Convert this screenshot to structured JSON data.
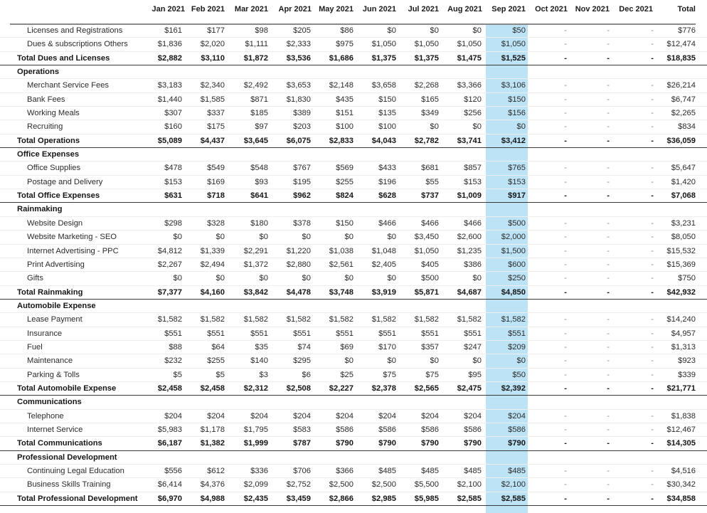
{
  "header": {
    "columns": [
      "Jan 2021",
      "Feb 2021",
      "Mar 2021",
      "Apr 2021",
      "May 2021",
      "Jun 2021",
      "Jul 2021",
      "Aug 2021",
      "Sep 2021",
      "Oct 2021",
      "Nov 2021",
      "Dec 2021",
      "Total"
    ],
    "highlighted_column": "Sep 2021"
  },
  "colors": {
    "highlight": "#bde3f6",
    "total_rule": "#3a3a3a",
    "header_rule": "#8a8a8a"
  },
  "rows": [
    {
      "type": "item",
      "label": "Licenses and Registrations",
      "values": [
        "$161",
        "$177",
        "$98",
        "$205",
        "$86",
        "$0",
        "$0",
        "$0",
        "$50",
        "-",
        "-",
        "-",
        "$776"
      ]
    },
    {
      "type": "item",
      "label": "Dues & subscriptions Others",
      "values": [
        "$1,836",
        "$2,020",
        "$1,111",
        "$2,333",
        "$975",
        "$1,050",
        "$1,050",
        "$1,050",
        "$1,050",
        "-",
        "-",
        "-",
        "$12,474"
      ]
    },
    {
      "type": "total",
      "label": "Total Dues and Licenses",
      "values": [
        "$2,882",
        "$3,110",
        "$1,872",
        "$3,536",
        "$1,686",
        "$1,375",
        "$1,375",
        "$1,475",
        "$1,525",
        "-",
        "-",
        "-",
        "$18,835"
      ]
    },
    {
      "type": "section",
      "label": "Operations"
    },
    {
      "type": "item",
      "label": "Merchant Service Fees",
      "values": [
        "$3,183",
        "$2,340",
        "$2,492",
        "$3,653",
        "$2,148",
        "$3,658",
        "$2,268",
        "$3,366",
        "$3,106",
        "-",
        "-",
        "-",
        "$26,214"
      ]
    },
    {
      "type": "item",
      "label": "Bank Fees",
      "values": [
        "$1,440",
        "$1,585",
        "$871",
        "$1,830",
        "$435",
        "$150",
        "$165",
        "$120",
        "$150",
        "-",
        "-",
        "-",
        "$6,747"
      ]
    },
    {
      "type": "item",
      "label": "Working Meals",
      "values": [
        "$307",
        "$337",
        "$185",
        "$389",
        "$151",
        "$135",
        "$349",
        "$256",
        "$156",
        "-",
        "-",
        "-",
        "$2,265"
      ]
    },
    {
      "type": "item",
      "label": "Recruiting",
      "values": [
        "$160",
        "$175",
        "$97",
        "$203",
        "$100",
        "$100",
        "$0",
        "$0",
        "$0",
        "-",
        "-",
        "-",
        "$834"
      ]
    },
    {
      "type": "total",
      "label": "Total Operations",
      "values": [
        "$5,089",
        "$4,437",
        "$3,645",
        "$6,075",
        "$2,833",
        "$4,043",
        "$2,782",
        "$3,741",
        "$3,412",
        "-",
        "-",
        "-",
        "$36,059"
      ]
    },
    {
      "type": "section",
      "label": "Office Expenses"
    },
    {
      "type": "item",
      "label": "Office Supplies",
      "values": [
        "$478",
        "$549",
        "$548",
        "$767",
        "$569",
        "$433",
        "$681",
        "$857",
        "$765",
        "-",
        "-",
        "-",
        "$5,647"
      ]
    },
    {
      "type": "item",
      "label": "Postage and Delivery",
      "values": [
        "$153",
        "$169",
        "$93",
        "$195",
        "$255",
        "$196",
        "$55",
        "$153",
        "$153",
        "-",
        "-",
        "-",
        "$1,420"
      ]
    },
    {
      "type": "total",
      "label": "Total Office Expenses",
      "values": [
        "$631",
        "$718",
        "$641",
        "$962",
        "$824",
        "$628",
        "$737",
        "$1,009",
        "$917",
        "-",
        "-",
        "-",
        "$7,068"
      ]
    },
    {
      "type": "section",
      "label": "Rainmaking"
    },
    {
      "type": "item",
      "label": "Website Design",
      "values": [
        "$298",
        "$328",
        "$180",
        "$378",
        "$150",
        "$466",
        "$466",
        "$466",
        "$500",
        "-",
        "-",
        "-",
        "$3,231"
      ]
    },
    {
      "type": "item",
      "label": "Website Marketing - SEO",
      "values": [
        "$0",
        "$0",
        "$0",
        "$0",
        "$0",
        "$0",
        "$3,450",
        "$2,600",
        "$2,000",
        "-",
        "-",
        "-",
        "$8,050"
      ]
    },
    {
      "type": "item",
      "label": "Internet Advertising - PPC",
      "values": [
        "$4,812",
        "$1,339",
        "$2,291",
        "$1,220",
        "$1,038",
        "$1,048",
        "$1,050",
        "$1,235",
        "$1,500",
        "-",
        "-",
        "-",
        "$15,532"
      ]
    },
    {
      "type": "item",
      "label": "Print Advertising",
      "values": [
        "$2,267",
        "$2,494",
        "$1,372",
        "$2,880",
        "$2,561",
        "$2,405",
        "$405",
        "$386",
        "$600",
        "-",
        "-",
        "-",
        "$15,369"
      ]
    },
    {
      "type": "item",
      "label": "Gifts",
      "values": [
        "$0",
        "$0",
        "$0",
        "$0",
        "$0",
        "$0",
        "$500",
        "$0",
        "$250",
        "-",
        "-",
        "-",
        "$750"
      ]
    },
    {
      "type": "total",
      "label": "Total Rainmaking",
      "values": [
        "$7,377",
        "$4,160",
        "$3,842",
        "$4,478",
        "$3,748",
        "$3,919",
        "$5,871",
        "$4,687",
        "$4,850",
        "-",
        "-",
        "-",
        "$42,932"
      ]
    },
    {
      "type": "section",
      "label": "Automobile Expense"
    },
    {
      "type": "item",
      "label": "Lease Payment",
      "values": [
        "$1,582",
        "$1,582",
        "$1,582",
        "$1,582",
        "$1,582",
        "$1,582",
        "$1,582",
        "$1,582",
        "$1,582",
        "-",
        "-",
        "-",
        "$14,240"
      ]
    },
    {
      "type": "item",
      "label": "Insurance",
      "values": [
        "$551",
        "$551",
        "$551",
        "$551",
        "$551",
        "$551",
        "$551",
        "$551",
        "$551",
        "-",
        "-",
        "-",
        "$4,957"
      ]
    },
    {
      "type": "item",
      "label": "Fuel",
      "values": [
        "$88",
        "$64",
        "$35",
        "$74",
        "$69",
        "$170",
        "$357",
        "$247",
        "$209",
        "-",
        "-",
        "-",
        "$1,313"
      ]
    },
    {
      "type": "item",
      "label": "Maintenance",
      "values": [
        "$232",
        "$255",
        "$140",
        "$295",
        "$0",
        "$0",
        "$0",
        "$0",
        "$0",
        "-",
        "-",
        "-",
        "$923"
      ]
    },
    {
      "type": "item",
      "label": "Parking & Tolls",
      "values": [
        "$5",
        "$5",
        "$3",
        "$6",
        "$25",
        "$75",
        "$75",
        "$95",
        "$50",
        "-",
        "-",
        "-",
        "$339"
      ]
    },
    {
      "type": "total",
      "label": "Total Automobile Expense",
      "values": [
        "$2,458",
        "$2,458",
        "$2,312",
        "$2,508",
        "$2,227",
        "$2,378",
        "$2,565",
        "$2,475",
        "$2,392",
        "-",
        "-",
        "-",
        "$21,771"
      ]
    },
    {
      "type": "section",
      "label": "Communications"
    },
    {
      "type": "item",
      "label": "Telephone",
      "values": [
        "$204",
        "$204",
        "$204",
        "$204",
        "$204",
        "$204",
        "$204",
        "$204",
        "$204",
        "-",
        "-",
        "-",
        "$1,838"
      ]
    },
    {
      "type": "item",
      "label": "Internet Service",
      "values": [
        "$5,983",
        "$1,178",
        "$1,795",
        "$583",
        "$586",
        "$586",
        "$586",
        "$586",
        "$586",
        "-",
        "-",
        "-",
        "$12,467"
      ]
    },
    {
      "type": "total",
      "label": "Total Communications",
      "values": [
        "$6,187",
        "$1,382",
        "$1,999",
        "$787",
        "$790",
        "$790",
        "$790",
        "$790",
        "$790",
        "-",
        "-",
        "-",
        "$14,305"
      ]
    },
    {
      "type": "section",
      "label": "Professional Development"
    },
    {
      "type": "item",
      "label": "Continuing Legal Education",
      "values": [
        "$556",
        "$612",
        "$336",
        "$706",
        "$366",
        "$485",
        "$485",
        "$485",
        "$485",
        "-",
        "-",
        "-",
        "$4,516"
      ]
    },
    {
      "type": "item",
      "label": "Business Skills Training",
      "values": [
        "$6,414",
        "$4,376",
        "$2,099",
        "$2,752",
        "$2,500",
        "$2,500",
        "$5,500",
        "$2,100",
        "$2,100",
        "-",
        "-",
        "-",
        "$30,342"
      ]
    },
    {
      "type": "total",
      "label": "Total Professional Development",
      "values": [
        "$6,970",
        "$4,988",
        "$2,435",
        "$3,459",
        "$2,866",
        "$2,985",
        "$5,985",
        "$2,585",
        "$2,585",
        "-",
        "-",
        "-",
        "$34,858"
      ]
    }
  ]
}
